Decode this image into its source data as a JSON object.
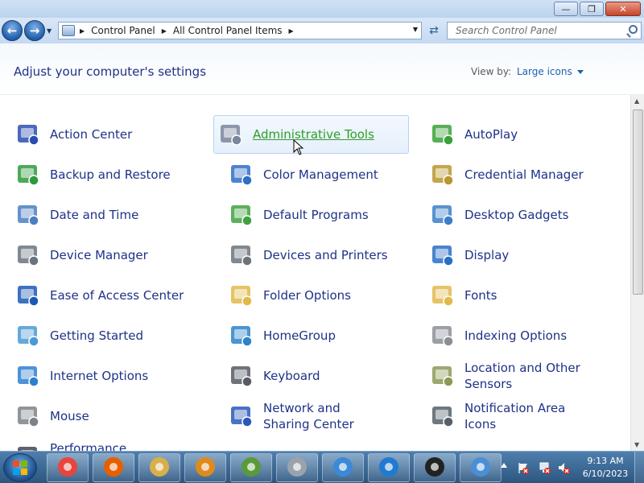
{
  "window": {
    "controls": {
      "minimize": "—",
      "maximize": "❐",
      "close": "✕"
    }
  },
  "nav": {
    "back_icon": "back-arrow-icon",
    "forward_icon": "forward-arrow-icon",
    "breadcrumb": [
      "Control Panel",
      "All Control Panel Items"
    ],
    "search_placeholder": "Search Control Panel"
  },
  "header": {
    "title": "Adjust your computer's settings",
    "view_by_label": "View by:",
    "view_by_value": "Large icons"
  },
  "items": [
    {
      "label": "Action Center",
      "icon": "flag-icon",
      "color": "#2b4fb0"
    },
    {
      "label": "Administrative Tools",
      "icon": "gear-checklist-icon",
      "color": "#7a8699",
      "hover": true
    },
    {
      "label": "AutoPlay",
      "icon": "autoplay-icon",
      "color": "#3aa13a"
    },
    {
      "label": "Backup and Restore",
      "icon": "backup-icon",
      "color": "#2e9a3c"
    },
    {
      "label": "Color Management",
      "icon": "color-management-icon",
      "color": "#2f6fc4"
    },
    {
      "label": "Credential Manager",
      "icon": "vault-icon",
      "color": "#b9962e"
    },
    {
      "label": "Date and Time",
      "icon": "calendar-clock-icon",
      "color": "#4a7fc1"
    },
    {
      "label": "Default Programs",
      "icon": "default-programs-icon",
      "color": "#3fa23f"
    },
    {
      "label": "Desktop Gadgets",
      "icon": "gadgets-icon",
      "color": "#3c7fc8"
    },
    {
      "label": "Device Manager",
      "icon": "device-manager-icon",
      "color": "#6a7480"
    },
    {
      "label": "Devices and Printers",
      "icon": "printer-icon",
      "color": "#6c737b"
    },
    {
      "label": "Display",
      "icon": "monitor-icon",
      "color": "#2a6fc6"
    },
    {
      "label": "Ease of Access Center",
      "icon": "ease-of-access-icon",
      "color": "#1c58b3"
    },
    {
      "label": "Folder Options",
      "icon": "folder-icon",
      "color": "#e2b84a"
    },
    {
      "label": "Fonts",
      "icon": "fonts-folder-icon",
      "color": "#e2b84a"
    },
    {
      "label": "Getting Started",
      "icon": "getting-started-icon",
      "color": "#4a9ad6"
    },
    {
      "label": "HomeGroup",
      "icon": "homegroup-icon",
      "color": "#2c83c9"
    },
    {
      "label": "Indexing Options",
      "icon": "indexing-icon",
      "color": "#8a8f96"
    },
    {
      "label": "Internet Options",
      "icon": "globe-icon",
      "color": "#2f7fd0"
    },
    {
      "label": "Keyboard",
      "icon": "keyboard-icon",
      "color": "#555b63"
    },
    {
      "label": "Location and Other Sensors",
      "icon": "sensors-icon",
      "color": "#8b9a55"
    },
    {
      "label": "Mouse",
      "icon": "mouse-icon",
      "color": "#7d8288"
    },
    {
      "label": "Network and Sharing Center",
      "icon": "network-icon",
      "color": "#2b58b8"
    },
    {
      "label": "Notification Area Icons",
      "icon": "notification-area-icon",
      "color": "#55606a"
    },
    {
      "label": "Performance Information",
      "icon": "performance-icon",
      "color": "#445"
    }
  ],
  "taskbar": {
    "start_icon": "windows-start-icon",
    "apps": [
      "chrome-icon",
      "firefox-icon",
      "explorer-icon",
      "search-magnifier-icon",
      "notepad-chart-icon",
      "printer-icon",
      "network-lock-icon",
      "internet-explorer-icon",
      "security-lock-icon",
      "control-panel-icon"
    ],
    "time": "9:13 AM",
    "date": "6/10/2023"
  }
}
